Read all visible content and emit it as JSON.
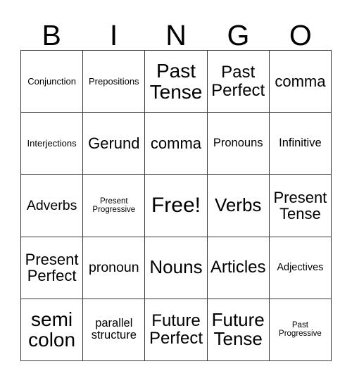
{
  "header": {
    "letters": [
      "B",
      "I",
      "N",
      "G",
      "O"
    ]
  },
  "colors": {
    "border": "#3a3a3a",
    "background": "#ffffff",
    "text": "#000000"
  },
  "grid": {
    "columns": 5,
    "rows": 5,
    "cells": [
      {
        "text": "Conjunction",
        "size": "s-sm"
      },
      {
        "text": "Prepositions",
        "size": "s-sm"
      },
      {
        "text": "Past\nTense",
        "size": "s-4xl"
      },
      {
        "text": "Past\nPerfect",
        "size": "s-xxl"
      },
      {
        "text": "comma",
        "size": "s-xl"
      },
      {
        "text": "Interjections",
        "size": "s-sm"
      },
      {
        "text": "Gerund",
        "size": "s-xl"
      },
      {
        "text": "comma",
        "size": "s-xl"
      },
      {
        "text": "Pronouns",
        "size": "s-md"
      },
      {
        "text": "Infinitive",
        "size": "s-md"
      },
      {
        "text": "Adverbs",
        "size": "s-lg"
      },
      {
        "text": "Present\nProgressive",
        "size": "s-xs"
      },
      {
        "text": "Free!",
        "size": "s-5xl"
      },
      {
        "text": "Verbs",
        "size": "s-3xl"
      },
      {
        "text": "Present\nTense",
        "size": "s-xl"
      },
      {
        "text": "Present\nPerfect",
        "size": "s-xl"
      },
      {
        "text": "pronoun",
        "size": "s-lg"
      },
      {
        "text": "Nouns",
        "size": "s-3xl"
      },
      {
        "text": "Articles",
        "size": "s-xxl"
      },
      {
        "text": "Adjectives",
        "size": "s-smp"
      },
      {
        "text": "semi\ncolon",
        "size": "s-4xl"
      },
      {
        "text": "parallel\nstructure",
        "size": "s-md"
      },
      {
        "text": "Future\nPerfect",
        "size": "s-xxl"
      },
      {
        "text": "Future\nTense",
        "size": "s-3xl"
      },
      {
        "text": "Past\nProgressive",
        "size": "s-xs"
      }
    ]
  }
}
